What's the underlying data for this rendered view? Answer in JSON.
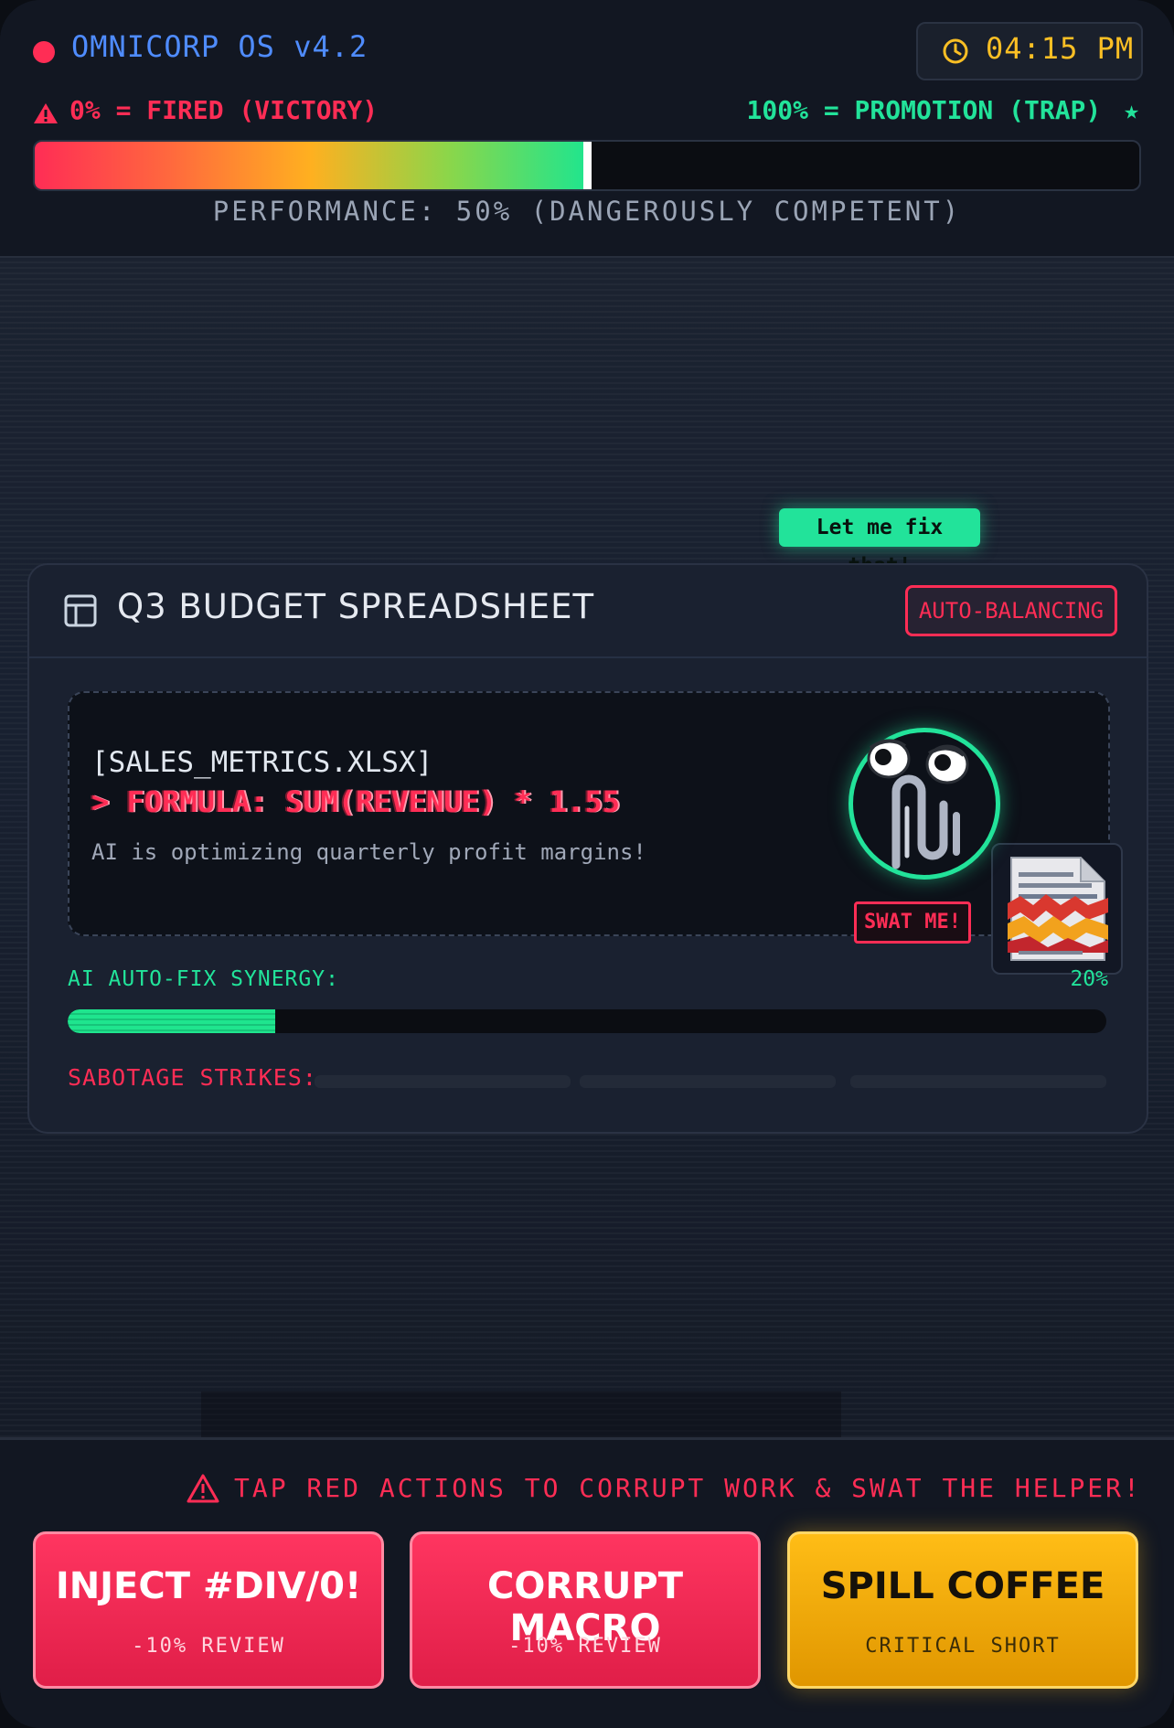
{
  "header": {
    "os_title": "OMNICORP OS v4.2",
    "clock": "04:15 PM",
    "fired_label": "0% = FIRED (VICTORY)",
    "promotion_label": "100% = PROMOTION (TRAP)",
    "performance_percent": 50,
    "performance_caption": "PERFORMANCE: 50% (DANGEROUSLY COMPETENT)"
  },
  "helper": {
    "speech": "Let me fix that!",
    "swat_label": "SWAT ME!"
  },
  "card": {
    "title": "Q3 BUDGET SPREADSHEET",
    "badge": "AUTO-BALANCING",
    "file_name": "[SALES_METRICS.XLSX]",
    "formula": "> FORMULA: SUM(REVENUE) * 1.55",
    "note": "AI is optimizing quarterly profit margins!",
    "synergy_label": "AI AUTO-FIX SYNERGY:",
    "synergy_value": "20%",
    "synergy_percent": 20,
    "strikes_label": "SABOTAGE STRIKES:",
    "strikes_filled": 0,
    "strikes_total": 3
  },
  "actions": {
    "hint": "TAP RED ACTIONS TO CORRUPT WORK & SWAT THE HELPER!",
    "buttons": [
      {
        "label": "INJECT #DIV/0!",
        "sub": "-10% REVIEW"
      },
      {
        "label": "CORRUPT MACRO",
        "sub": "-10% REVIEW"
      },
      {
        "label": "SPILL COFFEE",
        "sub": "CRITICAL SHORT"
      }
    ]
  },
  "colors": {
    "danger": "#ff2d55",
    "success": "#22e39a",
    "accent_blue": "#4f8cff",
    "warning": "#fbbf24"
  },
  "icons": [
    "recording-dot-icon",
    "clock-icon",
    "warning-icon",
    "star-icon",
    "spreadsheet-icon",
    "paperclip-helper-icon",
    "corrupted-document-icon"
  ]
}
